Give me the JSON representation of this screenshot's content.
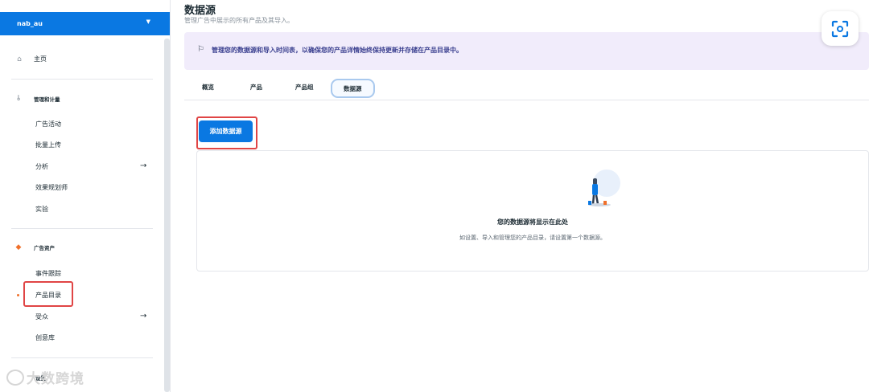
{
  "sidebar": {
    "account_name": "nab_au",
    "home": "主页",
    "section_manage": "管理和计量",
    "manage_items": [
      "广告活动",
      "批量上传",
      "分析",
      "效果规划师",
      "实验"
    ],
    "section_assets": "广告资产",
    "asset_items": [
      "事件跟踪",
      "产品目录",
      "受众",
      "创意库"
    ],
    "section_settings": "设置"
  },
  "watermark": "大数跨境",
  "page": {
    "title": "数据源",
    "subtitle": "管理广告中展示的所有产品及其导入。",
    "banner": "管理您的数据源和导入时间表，以确保您的产品详情始终保持更新并存储在产品目录中。"
  },
  "tabs": [
    "概览",
    "产品",
    "产品组",
    "数据源"
  ],
  "active_tab": "数据源",
  "add_button": "添加数据源",
  "empty_state": {
    "title": "您的数据源将显示在此处",
    "description": "如设置、导入和管理您的产品目录，请设置第一个数据源。"
  },
  "colors": {
    "primary": "#0a78e2",
    "banner_bg": "#f1ecfb",
    "highlight": "#e04545",
    "active_dot": "#f0702b"
  }
}
